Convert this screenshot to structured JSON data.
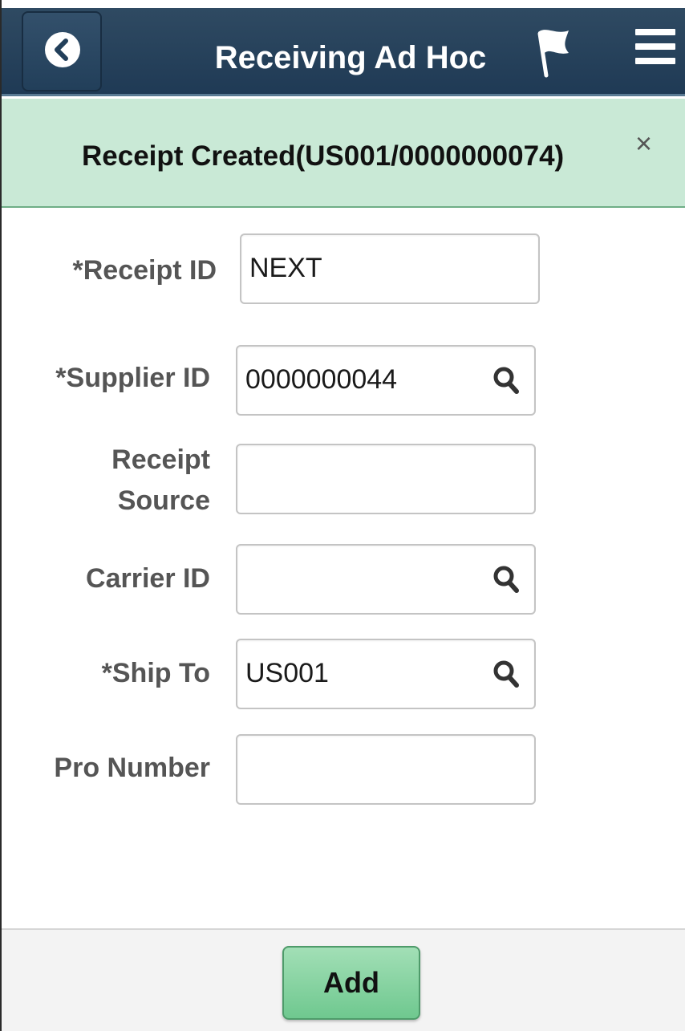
{
  "header": {
    "title": "Receiving Ad Hoc",
    "back_icon": "chevron-left-icon",
    "flag_icon": "flag-icon",
    "menu_icon": "hamburger-menu-icon"
  },
  "banner": {
    "message": "Receipt Created(US001/0000000074)",
    "close_glyph": "×",
    "color": "#c9e9d6"
  },
  "form": {
    "receipt_id": {
      "label": "*Receipt ID",
      "value": "NEXT"
    },
    "supplier_id": {
      "label": "*Supplier ID",
      "value": "0000000044"
    },
    "receipt_source": {
      "label_line1": "Receipt",
      "label_line2": "Source",
      "value": ""
    },
    "carrier_id": {
      "label": "Carrier ID",
      "value": ""
    },
    "ship_to": {
      "label": "*Ship To",
      "value": "US001"
    },
    "pro_number": {
      "label": "Pro Number",
      "value": ""
    }
  },
  "footer": {
    "add_label": "Add",
    "add_color": "#6fc88f"
  }
}
